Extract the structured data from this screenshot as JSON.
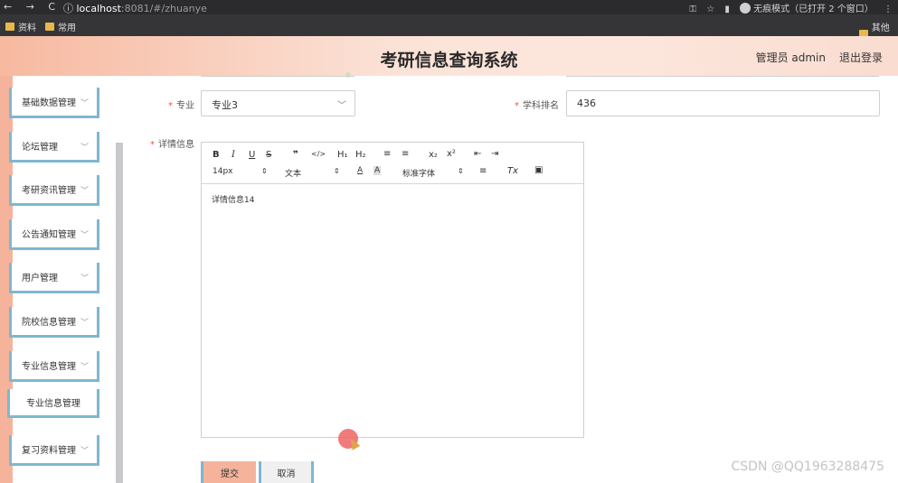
{
  "browser": {
    "nav": "← → C",
    "url_host": "localhost",
    "url_path": ":8081/#/zhuanye",
    "incognito": "无痕模式（已打开 2 个窗口）",
    "bookmarks": [
      "资料",
      "常用"
    ],
    "other_bookmarks": "其他书"
  },
  "header": {
    "title": "考研信息查询系统",
    "admin": "管理员 admin",
    "logout": "退出登录"
  },
  "sidebar": {
    "items": [
      {
        "label": "基础数据管理"
      },
      {
        "label": "论坛管理"
      },
      {
        "label": "考研资讯管理"
      },
      {
        "label": "公告通知管理"
      },
      {
        "label": "用户管理"
      },
      {
        "label": "院校信息管理"
      },
      {
        "label": "专业信息管理"
      },
      {
        "label": "复习资料管理"
      }
    ],
    "sub_item": "专业信息管理"
  },
  "form": {
    "major_label": "专业",
    "major_value": "专业3",
    "rank_label": "学科排名",
    "rank_value": "436",
    "detail_label": "详情信息",
    "toolbar": {
      "bold": "B",
      "italic": "I",
      "underline": "U",
      "strike": "S",
      "quote": "❞",
      "code": "</>",
      "h1": "H₁",
      "h2": "H₂",
      "ol": "≡",
      "ul": "≡",
      "sub": "x₂",
      "sup": "x²",
      "indent_l": "⇤",
      "indent_r": "⇥",
      "size": "14px",
      "type": "文本",
      "color": "A",
      "bg": "A",
      "font": "标准字体",
      "align": "≡",
      "clear": "Tx",
      "image": "▣"
    },
    "detail_value": "详情信息14",
    "submit": "提交",
    "cancel": "取消"
  },
  "watermark": "CSDN @QQ1963288475"
}
